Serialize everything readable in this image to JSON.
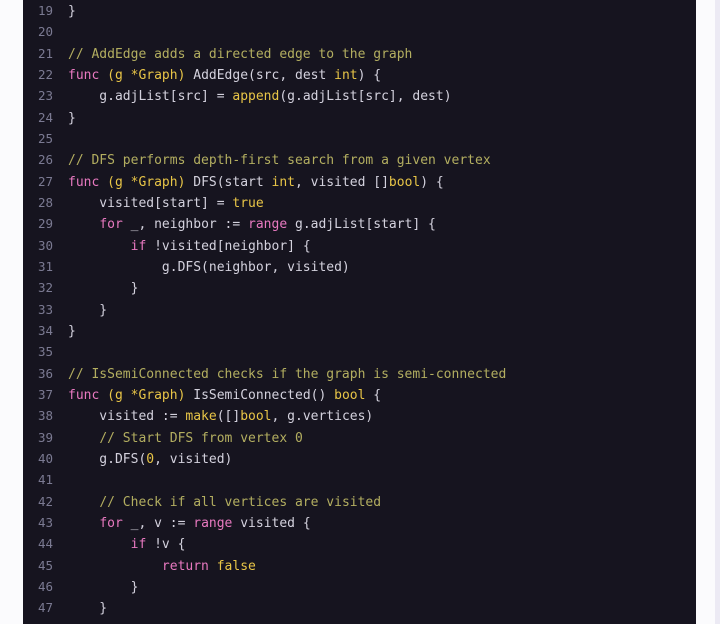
{
  "editor": {
    "language": "go",
    "background_color": "#16141f",
    "page_color": "#fbfbfd",
    "gutter_color": "#7b7a92",
    "first_visible_line": 19,
    "last_visible_line": 47,
    "colors": {
      "comment": "#b3ae60",
      "keyword": "#e879c0",
      "type_literal": "#e8c547",
      "plain": "#d4d2de",
      "line_number": "#7b7a92"
    },
    "lines": [
      {
        "num": "19",
        "tokens": [
          {
            "t": "}",
            "c": "t-pln"
          }
        ]
      },
      {
        "num": "20",
        "tokens": []
      },
      {
        "num": "21",
        "tokens": [
          {
            "t": "// AddEdge adds a directed edge to the graph",
            "c": "t-com"
          }
        ]
      },
      {
        "num": "22",
        "tokens": [
          {
            "t": "func",
            "c": "t-kw"
          },
          {
            "t": " ",
            "c": "t-pln"
          },
          {
            "t": "(g *Graph)",
            "c": "t-type"
          },
          {
            "t": " AddEdge(src, dest ",
            "c": "t-pln"
          },
          {
            "t": "int",
            "c": "t-type"
          },
          {
            "t": ") {",
            "c": "t-pln"
          }
        ]
      },
      {
        "num": "23",
        "tokens": [
          {
            "t": "    g.adjList[src] = ",
            "c": "t-pln"
          },
          {
            "t": "append",
            "c": "t-type"
          },
          {
            "t": "(g.adjList[src], dest)",
            "c": "t-pln"
          }
        ]
      },
      {
        "num": "24",
        "tokens": [
          {
            "t": "}",
            "c": "t-pln"
          }
        ]
      },
      {
        "num": "25",
        "tokens": []
      },
      {
        "num": "26",
        "tokens": [
          {
            "t": "// DFS performs depth-first search from a given vertex",
            "c": "t-com"
          }
        ]
      },
      {
        "num": "27",
        "tokens": [
          {
            "t": "func",
            "c": "t-kw"
          },
          {
            "t": " ",
            "c": "t-pln"
          },
          {
            "t": "(g *Graph)",
            "c": "t-type"
          },
          {
            "t": " DFS(start ",
            "c": "t-pln"
          },
          {
            "t": "int",
            "c": "t-type"
          },
          {
            "t": ", visited []",
            "c": "t-pln"
          },
          {
            "t": "bool",
            "c": "t-type"
          },
          {
            "t": ") {",
            "c": "t-pln"
          }
        ]
      },
      {
        "num": "28",
        "tokens": [
          {
            "t": "    visited[start] = ",
            "c": "t-pln"
          },
          {
            "t": "true",
            "c": "t-type"
          }
        ]
      },
      {
        "num": "29",
        "tokens": [
          {
            "t": "    ",
            "c": "t-pln"
          },
          {
            "t": "for",
            "c": "t-kw"
          },
          {
            "t": " _, neighbor := ",
            "c": "t-pln"
          },
          {
            "t": "range",
            "c": "t-kw"
          },
          {
            "t": " g.adjList[start] {",
            "c": "t-pln"
          }
        ]
      },
      {
        "num": "30",
        "tokens": [
          {
            "t": "        ",
            "c": "t-pln"
          },
          {
            "t": "if",
            "c": "t-kw"
          },
          {
            "t": " !visited[neighbor] {",
            "c": "t-pln"
          }
        ]
      },
      {
        "num": "31",
        "tokens": [
          {
            "t": "            g.DFS(neighbor, visited)",
            "c": "t-pln"
          }
        ]
      },
      {
        "num": "32",
        "tokens": [
          {
            "t": "        }",
            "c": "t-pln"
          }
        ]
      },
      {
        "num": "33",
        "tokens": [
          {
            "t": "    }",
            "c": "t-pln"
          }
        ]
      },
      {
        "num": "34",
        "tokens": [
          {
            "t": "}",
            "c": "t-pln"
          }
        ]
      },
      {
        "num": "35",
        "tokens": []
      },
      {
        "num": "36",
        "tokens": [
          {
            "t": "// IsSemiConnected checks if the graph is semi-connected",
            "c": "t-com"
          }
        ]
      },
      {
        "num": "37",
        "tokens": [
          {
            "t": "func",
            "c": "t-kw"
          },
          {
            "t": " ",
            "c": "t-pln"
          },
          {
            "t": "(g *Graph)",
            "c": "t-type"
          },
          {
            "t": " IsSemiConnected() ",
            "c": "t-pln"
          },
          {
            "t": "bool",
            "c": "t-type"
          },
          {
            "t": " {",
            "c": "t-pln"
          }
        ]
      },
      {
        "num": "38",
        "tokens": [
          {
            "t": "    visited := ",
            "c": "t-pln"
          },
          {
            "t": "make",
            "c": "t-type"
          },
          {
            "t": "([]",
            "c": "t-pln"
          },
          {
            "t": "bool",
            "c": "t-type"
          },
          {
            "t": ", g.vertices)",
            "c": "t-pln"
          }
        ]
      },
      {
        "num": "39",
        "tokens": [
          {
            "t": "    ",
            "c": "t-pln"
          },
          {
            "t": "// Start DFS from vertex 0",
            "c": "t-com"
          }
        ]
      },
      {
        "num": "40",
        "tokens": [
          {
            "t": "    g.DFS(",
            "c": "t-pln"
          },
          {
            "t": "0",
            "c": "t-type"
          },
          {
            "t": ", visited)",
            "c": "t-pln"
          }
        ]
      },
      {
        "num": "41",
        "tokens": []
      },
      {
        "num": "42",
        "tokens": [
          {
            "t": "    ",
            "c": "t-pln"
          },
          {
            "t": "// Check if all vertices are visited",
            "c": "t-com"
          }
        ]
      },
      {
        "num": "43",
        "tokens": [
          {
            "t": "    ",
            "c": "t-pln"
          },
          {
            "t": "for",
            "c": "t-kw"
          },
          {
            "t": " _, v := ",
            "c": "t-pln"
          },
          {
            "t": "range",
            "c": "t-kw"
          },
          {
            "t": " visited {",
            "c": "t-pln"
          }
        ]
      },
      {
        "num": "44",
        "tokens": [
          {
            "t": "        ",
            "c": "t-pln"
          },
          {
            "t": "if",
            "c": "t-kw"
          },
          {
            "t": " !v {",
            "c": "t-pln"
          }
        ]
      },
      {
        "num": "45",
        "tokens": [
          {
            "t": "            ",
            "c": "t-pln"
          },
          {
            "t": "return",
            "c": "t-kw"
          },
          {
            "t": " ",
            "c": "t-pln"
          },
          {
            "t": "false",
            "c": "t-type"
          }
        ]
      },
      {
        "num": "46",
        "tokens": [
          {
            "t": "        }",
            "c": "t-pln"
          }
        ]
      },
      {
        "num": "47",
        "tokens": [
          {
            "t": "    }",
            "c": "t-pln"
          }
        ]
      }
    ]
  }
}
